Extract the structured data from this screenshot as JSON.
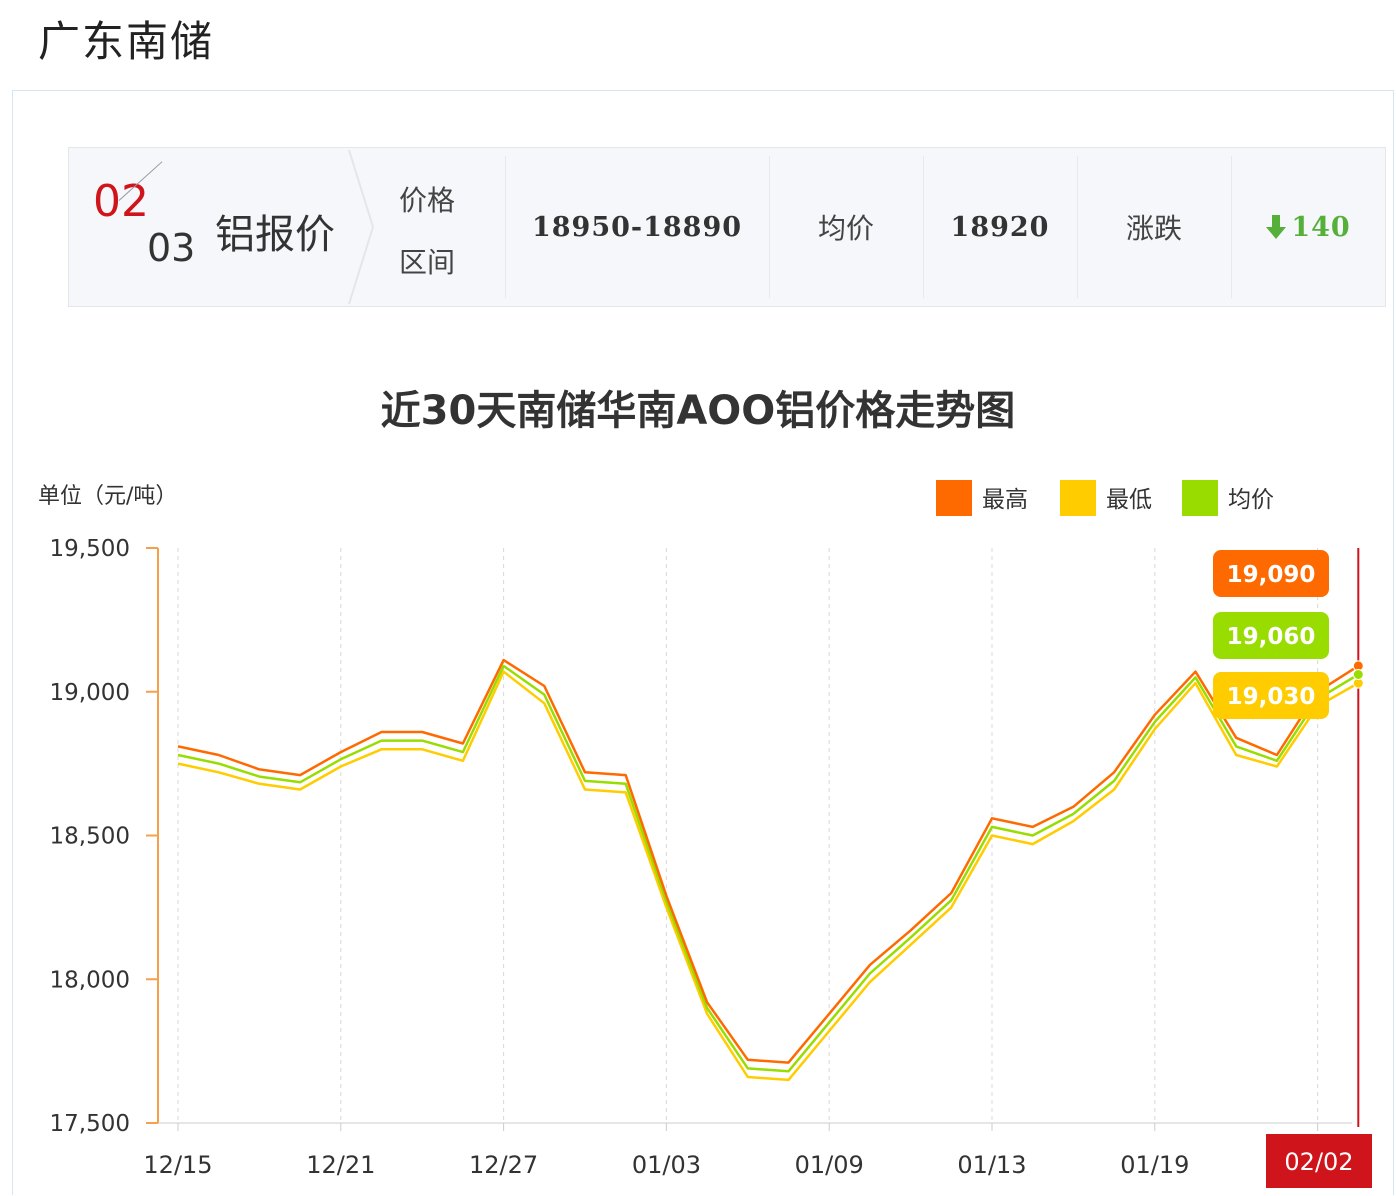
{
  "page_title": "广东南储",
  "quote": {
    "date_month": "02",
    "date_day": "03",
    "product": "铝报价",
    "range_label_1": "价格",
    "range_label_2": "区间",
    "range_value": "18950-18890",
    "avg_label": "均价",
    "avg_value": "18920",
    "change_label": "涨跌",
    "change_value": "140",
    "change_direction": "down",
    "change_color": "#55b03a"
  },
  "chart_data": {
    "type": "line",
    "title": "近30天南储华南AOO铝价格走势图",
    "ylabel": "单位（元/吨）",
    "ylim": [
      17500,
      19500
    ],
    "yticks": [
      "19,500",
      "19,000",
      "18,500",
      "18,000",
      "17,500"
    ],
    "x_ticks": [
      "12/15",
      "12/21",
      "12/27",
      "01/03",
      "01/09",
      "01/13",
      "01/19",
      "02/02"
    ],
    "highlight_tick": "02/02",
    "grid": "vertical-dashed",
    "legend_position": "top-right",
    "series": [
      {
        "name": "最高",
        "color": "#ff6a00",
        "values": [
          18810,
          18780,
          18730,
          18710,
          18790,
          18860,
          18860,
          18820,
          19110,
          19020,
          18720,
          18710,
          18290,
          17920,
          17720,
          17710,
          17880,
          18050,
          18170,
          18300,
          18560,
          18530,
          18600,
          18720,
          18920,
          19070,
          18840,
          18780,
          19000,
          19090
        ]
      },
      {
        "name": "最低",
        "color": "#ffcc00",
        "values": [
          18750,
          18720,
          18680,
          18660,
          18740,
          18800,
          18800,
          18760,
          19070,
          18960,
          18660,
          18650,
          18250,
          17880,
          17660,
          17650,
          17820,
          17990,
          18120,
          18250,
          18500,
          18470,
          18550,
          18660,
          18870,
          19030,
          18780,
          18740,
          18950,
          19030
        ]
      },
      {
        "name": "均价",
        "color": "#99dd00",
        "values": [
          18780,
          18750,
          18705,
          18685,
          18765,
          18830,
          18830,
          18790,
          19090,
          18990,
          18690,
          18680,
          18270,
          17900,
          17690,
          17680,
          17850,
          18020,
          18145,
          18275,
          18530,
          18500,
          18575,
          18690,
          18895,
          19050,
          18810,
          18760,
          18975,
          19060
        ]
      }
    ],
    "latest_labels": [
      {
        "series": "最高",
        "text": "19,090",
        "color": "#ff6a00"
      },
      {
        "series": "均价",
        "text": "19,060",
        "color": "#99dd00"
      },
      {
        "series": "最低",
        "text": "19,030",
        "color": "#ffcc00"
      }
    ]
  }
}
